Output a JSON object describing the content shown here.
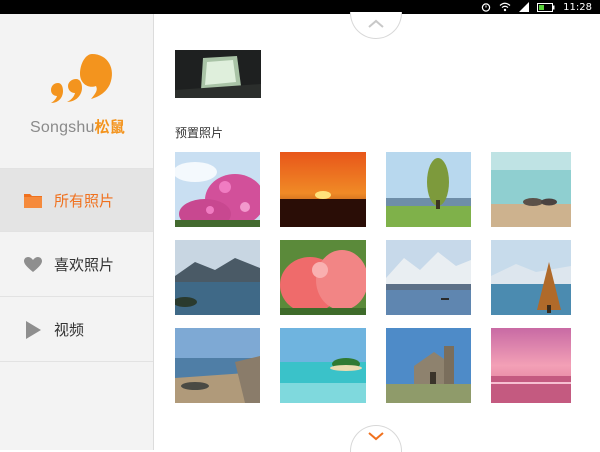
{
  "status_bar": {
    "time": "11:28"
  },
  "brand": {
    "name_en": "Songshu",
    "name_cn": "松鼠",
    "accent_color": "#f3941e"
  },
  "sidebar": {
    "items": [
      {
        "label": "所有照片",
        "icon": "folder-icon",
        "active": true
      },
      {
        "label": "喜欢照片",
        "icon": "heart-icon",
        "active": false
      },
      {
        "label": "视频",
        "icon": "play-icon",
        "active": false
      }
    ]
  },
  "gallery": {
    "section_title": "预置照片",
    "photos": [
      "laptop-screen-photo",
      "pink-flowers-photo",
      "sunset-photo",
      "tree-meadow-photo",
      "ducks-lake-photo",
      "lake-mountains-photo",
      "coral-shrub-photo",
      "snow-mountains-photo",
      "lake-tree-photo",
      "rocky-coast-photo",
      "tropical-island-photo",
      "stone-church-photo",
      "pink-sky-sea-photo"
    ]
  }
}
